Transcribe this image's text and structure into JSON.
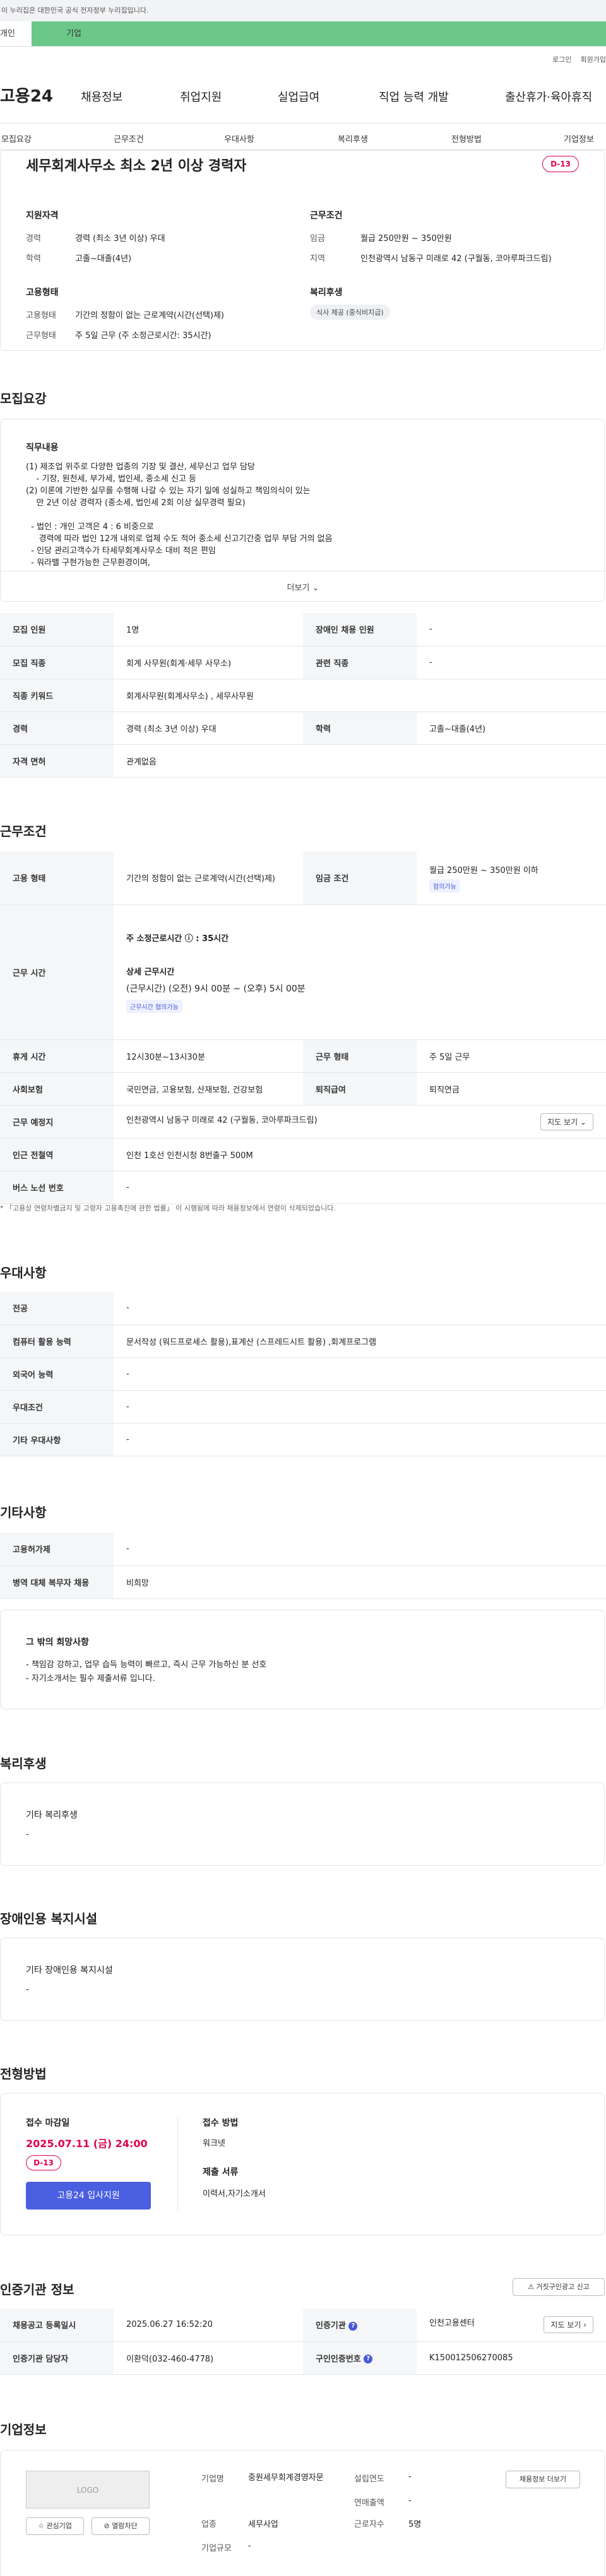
{
  "gov_banner": "이 누리집은 대한민국 공식 전자정부 누리집입니다.",
  "user_tabs": {
    "individual": "개인",
    "business": "기업"
  },
  "top_links": {
    "login": "로그인",
    "join": "회원가입"
  },
  "logo": "고용24",
  "gnb": [
    "채용정보",
    "취업지원",
    "실업급여",
    "직업 능력 개발",
    "출산휴가·육아휴직"
  ],
  "anchor_tabs": [
    "모집요강",
    "근무조건",
    "우대사항",
    "복리후생",
    "전형방법",
    "기업정보"
  ],
  "summary": {
    "title": "세무회계사무소 최소 2년 이상 경력자",
    "dday": "D-13",
    "qual_head": "지원자격",
    "career_label": "경력",
    "career_value": "경력 (최소 3년 이상) 우대",
    "edu_label": "학력",
    "edu_value": "고졸~대졸(4년)",
    "cond_head": "근무조건",
    "wage_label": "임금",
    "wage_value": "월급 250만원 ~ 350만원",
    "region_label": "지역",
    "region_value": "인천광역시 남동구 미래로 42 (구월동, 코아루파크드림)",
    "emp_head": "고용형태",
    "emptype_label": "고용형태",
    "emptype_value": "기간의 정함이 없는 근로계약(시간(선택)제)",
    "worktype_label": "근무형태",
    "worktype_value": "주 5일 근무 (주 소정근로시간: 35시간)",
    "welfare_head": "복리후생",
    "welfare_chip": "식사 제공 (중식비지급)"
  },
  "recruit": {
    "section_title": "모집요강",
    "duty_head": "직무내용",
    "duty_text": "(1) 제조업 위주로 다양한 업종의 기장 및 결산, 세무신고 업무 담당\n    - 기장, 원천세, 부가세, 법인세, 종소세 신고 등\n(2) 이론에 기반한 실무를 수행해 나갈 수 있는 자기 일에 성실하고 책임의식이 있는\n    만 2년 이상 경력자 (종소세, 법인세 2회 이상 실무경력 필요)\n\n  - 법인 : 개인 고객은 4 : 6 비중으로\n     경력에 따라 법인 12개 내외로 업체 수도 적어 종소세 신고기간중 업무 부담 거의 없음\n  - 인당 관리고객수가 타세무회계사무소 대비 적은 편임\n  - 워라밸 구현가능한 근무환경이며,",
    "more": "더보기 ⌄",
    "rows": [
      [
        "모집 인원",
        "1명",
        "장애인 채용 인원",
        "-"
      ],
      [
        "모집 직종",
        "회계 사무원(회계·세무 사무소)",
        "관련 직종",
        "-"
      ],
      [
        "직종 키워드",
        "회계사무원(회계사무소) , 세무사무원",
        "",
        ""
      ],
      [
        "경력",
        "경력 (최소 3년 이상) 우대",
        "학력",
        "고졸~대졸(4년)"
      ],
      [
        "자격 면허",
        "관계없음",
        "",
        ""
      ]
    ]
  },
  "conditions": {
    "section_title": "근무조건",
    "emp_type_label": "고용 형태",
    "emp_type_value": "기간의 정함이 없는 근로계약(시간(선택)제)",
    "wage_label": "임금 조건",
    "wage_value": "월급 250만원 ~ 350만원 이하",
    "wage_tag": "협의가능",
    "hours_label": "근무 시간",
    "weekly_hours": "주 소정근로시간 ⓘ : 35시간",
    "detail_hours_head": "상세 근무시간",
    "detail_hours": "(근무시간) (오전) 9시 00분 ~ (오후) 5시 00분",
    "hours_tag": "근무시간 협의가능",
    "break_label": "휴게 시간",
    "break_value": "12시30분~13시30분",
    "worktype_label": "근무 형태",
    "worktype_value": "주 5일 근무",
    "insurance_label": "사회보험",
    "insurance_value": "국민연금, 고용보험, 산재보험, 건강보험",
    "severance_label": "퇴직급여",
    "severance_value": "퇴직연금",
    "place_label": "근무 예정지",
    "place_value": "인천광역시 남동구 미래로 42 (구월동, 코아루파크드림)",
    "map_btn": "지도 보기 ⌄",
    "subway_label": "인근 전철역",
    "subway_value": "인천 1호선 인천시청 8번출구 500M",
    "bus_label": "버스 노선 번호",
    "bus_value": "-",
    "note": "* 「고용상 연령차별금지 및 고령자 고용촉진에 관한 법률」 이 시행됨에 따라 채용정보에서 연령이 삭제되었습니다."
  },
  "preference": {
    "section_title": "우대사항",
    "rows": [
      [
        "전공",
        "-"
      ],
      [
        "컴퓨터 활용 능력",
        "문서작성 (워드프로세스 활용),표계산 (스프레드시트 활용) ,회계프로그램"
      ],
      [
        "외국어 능력",
        "-"
      ],
      [
        "우대조건",
        "-"
      ],
      [
        "기타 우대사항",
        "-"
      ]
    ]
  },
  "etc": {
    "section_title": "기타사항",
    "rows": [
      [
        "고용허가제",
        "-"
      ],
      [
        "병역 대체 복무자 채용",
        "비희망"
      ]
    ],
    "hope_head": "그 밖의 희망사항",
    "hope_text": "- 책임감 강하고, 업무 습득 능력이 빠르고, 즉시 근무 가능하신 분 선호\n- 자기소개서는 필수 제출서류 입니다."
  },
  "welfare": {
    "section_title": "복리후생",
    "head": "기타 복리후생",
    "value": "-"
  },
  "disability": {
    "section_title": "장애인용 복지시설",
    "head": "기타 장애인용 복지시설",
    "value": "-"
  },
  "selection": {
    "section_title": "전형방법",
    "deadline_head": "접수 마감일",
    "deadline": "2025.07.11 (금) 24:00",
    "dday": "D-13",
    "apply_btn": "고용24 입사지원",
    "method_head": "접수 방법",
    "method": "워크넷",
    "docs_head": "제출 서류",
    "docs": "이력서,자기소개서"
  },
  "agency": {
    "section_title": "인증기관 정보",
    "report_btn": "⚠ 거짓구인광고 신고",
    "reg_label": "채용공고 등록일시",
    "reg_value": "2025.06.27 16:52:20",
    "org_label": "인증기관",
    "org_value": "인천고용센터",
    "map_btn": "지도 보기 ›",
    "manager_label": "인증기관 담당자",
    "manager_value": "이환덕(032-460-4778)",
    "jobno_label": "구인인증번호",
    "jobno_value": "K150012506270085"
  },
  "company": {
    "section_title": "기업정보",
    "logo_text": "LOGO",
    "interest_btn": "☆ 관심기업",
    "block_btn": "⊘ 열람차단",
    "name_label": "기업명",
    "name_value": "중원세무회계경영자문",
    "ind_label": "업종",
    "ind_value": "세무사업",
    "size_label": "기업규모",
    "size_value": "-",
    "est_label": "설립연도",
    "est_value": "-",
    "sales_label": "연매출액",
    "sales_value": "-",
    "emp_label": "근로자수",
    "emp_value": "5명",
    "list_btn": "채용정보 더보기"
  }
}
